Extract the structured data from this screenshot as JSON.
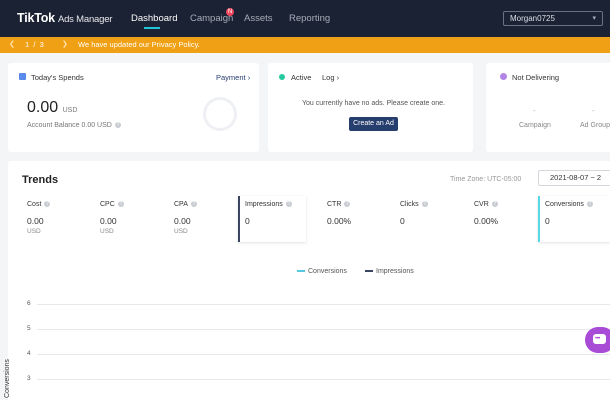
{
  "nav": {
    "brand": "TikTok",
    "brand_sub": "Ads Manager",
    "items": [
      "Dashboard",
      "Campaign",
      "Assets",
      "Reporting"
    ],
    "active": "Dashboard",
    "campaign_badge": "N",
    "account": "Morgan0725"
  },
  "banner": {
    "current": "1",
    "separator": "/",
    "total": "3",
    "message": "We have updated our Privacy Policy."
  },
  "spends": {
    "title": "Today's Spends",
    "payment_link": "Payment",
    "amount": "0.00",
    "currency": "USD",
    "balance_label": "Account Balance 0.00 USD"
  },
  "active_card": {
    "status": "Active",
    "log_link": "Log",
    "empty_message": "You currently have no ads. Please create one.",
    "create_button": "Create an Ad"
  },
  "not_delivering": {
    "title": "Not Delivering",
    "col1_value": "-",
    "col1_label": "Campaign",
    "col2_value": "-",
    "col2_label": "Ad Group"
  },
  "trends": {
    "title": "Trends",
    "timezone": "Time Zone: UTC-05:00",
    "date_range": "2021-08-07   ~   2",
    "metrics": [
      {
        "label": "Cost",
        "value": "0.00",
        "unit": "USD"
      },
      {
        "label": "CPC",
        "value": "0.00",
        "unit": "USD"
      },
      {
        "label": "CPA",
        "value": "0.00",
        "unit": "USD"
      },
      {
        "label": "Impressions",
        "value": "0",
        "unit": ""
      },
      {
        "label": "CTR",
        "value": "0.00%",
        "unit": ""
      },
      {
        "label": "Clicks",
        "value": "0",
        "unit": ""
      },
      {
        "label": "CVR",
        "value": "0.00%",
        "unit": ""
      },
      {
        "label": "Conversions",
        "value": "0",
        "unit": ""
      }
    ]
  },
  "chart": {
    "legend": [
      {
        "name": "Conversions",
        "color": "#56c8e0"
      },
      {
        "name": "Impressions",
        "color": "#3a4561"
      }
    ],
    "y_ticks": [
      "6",
      "5",
      "4",
      "3"
    ],
    "y_label": "Conversions"
  },
  "colors": {
    "nav_bg": "#1b2233",
    "accent": "#22c7d6",
    "banner": "#f0a014",
    "primary_button": "#263e6e",
    "chat": "#a84bd6"
  }
}
